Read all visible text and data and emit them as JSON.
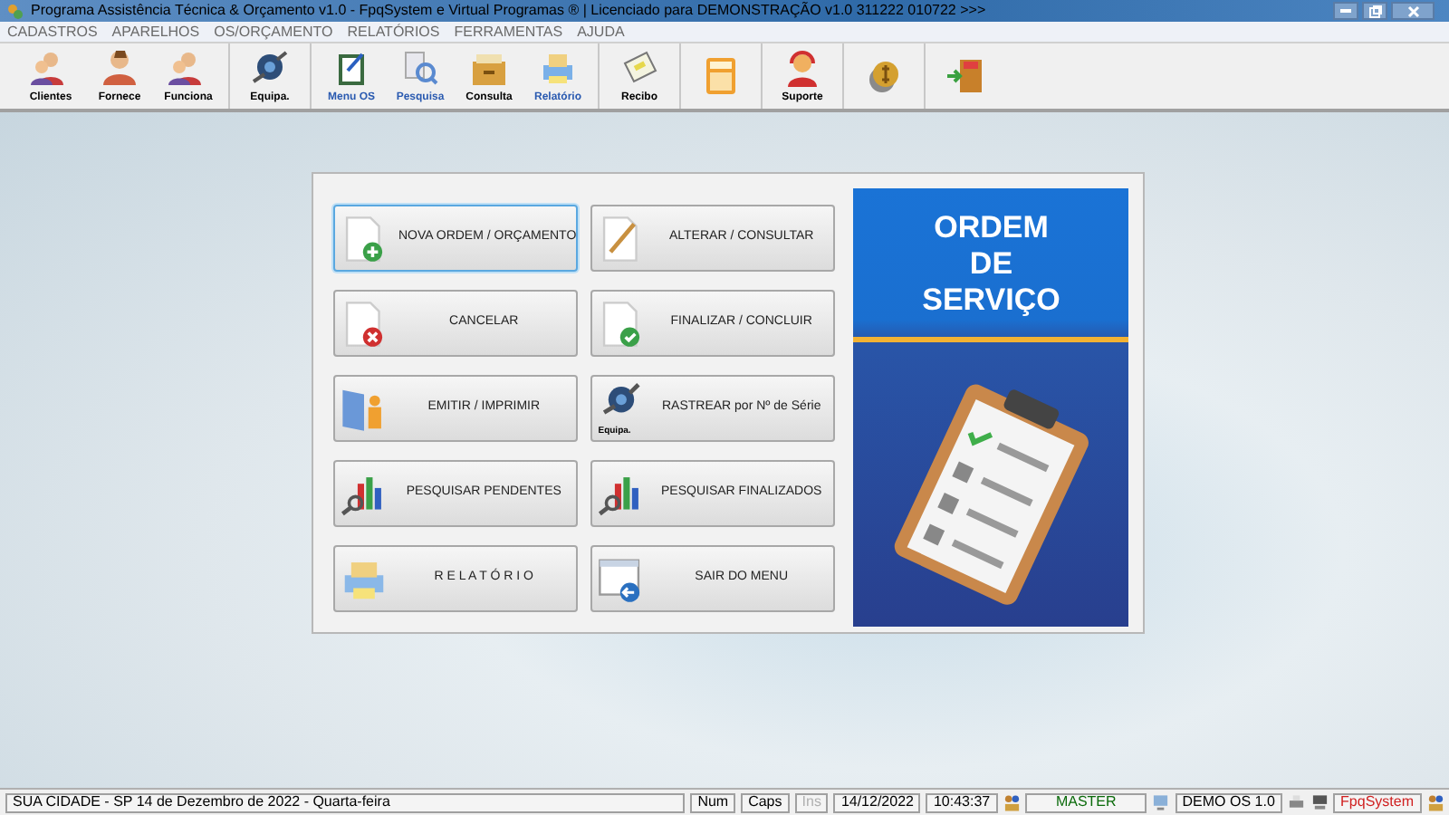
{
  "window": {
    "title": "Programa Assistência Técnica & Orçamento v1.0 - FpqSystem e Virtual Programas ® | Licenciado para  DEMONSTRAÇÃO v1.0 311222 010722 >>>"
  },
  "menu": [
    "CADASTROS",
    "APARELHOS",
    "OS/ORÇAMENTO",
    "RELATÓRIOS",
    "FERRAMENTAS",
    "AJUDA"
  ],
  "toolbar": [
    [
      {
        "kind": "people",
        "label": "Clientes"
      },
      {
        "kind": "person",
        "label": "Fornece"
      },
      {
        "kind": "people",
        "label": "Funciona"
      }
    ],
    [
      {
        "kind": "device",
        "label": "Equipa."
      }
    ],
    [
      {
        "kind": "clipboard",
        "label": "Menu OS",
        "blue": true
      },
      {
        "kind": "search",
        "label": "Pesquisa",
        "blue": true
      },
      {
        "kind": "drawer",
        "label": "Consulta",
        "blue": false
      },
      {
        "kind": "printer",
        "label": "Relatório",
        "blue": true
      }
    ],
    [
      {
        "kind": "receipt",
        "label": "Recibo"
      }
    ],
    [
      {
        "kind": "calculator"
      }
    ],
    [
      {
        "kind": "support",
        "label": "Suporte"
      }
    ],
    [
      {
        "kind": "coin"
      }
    ],
    [
      {
        "kind": "exit"
      }
    ]
  ],
  "buttons": [
    {
      "label": "NOVA ORDEM / ORÇAMENTO",
      "kind": "new",
      "focused": true
    },
    {
      "label": "ALTERAR / CONSULTAR",
      "kind": "edit",
      "focused": false
    },
    {
      "label": "CANCELAR",
      "kind": "cancel",
      "focused": false
    },
    {
      "label": "FINALIZAR / CONCLUIR",
      "kind": "finish",
      "focused": false
    },
    {
      "label": "EMITIR / IMPRIMIR",
      "kind": "issue",
      "focused": false
    },
    {
      "label": "RASTREAR por Nº de Série",
      "kind": "track",
      "icon_caption": "Equipa.",
      "focused": false
    },
    {
      "label": "PESQUISAR PENDENTES",
      "kind": "search",
      "focused": false
    },
    {
      "label": "PESQUISAR FINALIZADOS",
      "kind": "search",
      "focused": false
    },
    {
      "label": "R E L A T Ó R I O",
      "kind": "report",
      "focused": false
    },
    {
      "label": "SAIR DO MENU",
      "kind": "exit",
      "focused": false
    }
  ],
  "banner": {
    "title": "ORDEM DE SERVIÇO"
  },
  "status_bar": {
    "location": "SUA CIDADE - SP 14 de Dezembro de 2022 - Quarta-feira",
    "keys": [
      {
        "label": "Num",
        "disabled": false
      },
      {
        "label": "Caps",
        "disabled": false
      },
      {
        "label": "Ins",
        "disabled": true
      }
    ],
    "date": "14/12/2022",
    "time": "10:43:37",
    "user": "MASTER",
    "version": "DEMO OS 1.0",
    "brand": "FpqSystem"
  }
}
